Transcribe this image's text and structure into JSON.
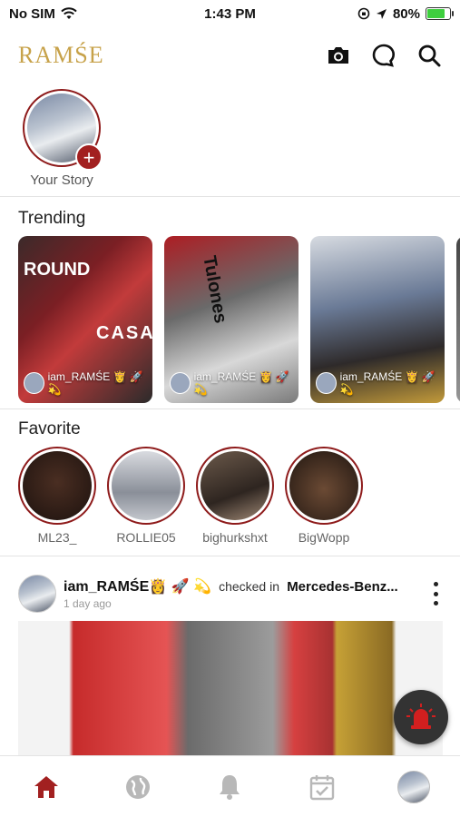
{
  "status_bar": {
    "carrier": "No SIM",
    "time": "1:43 PM",
    "battery_percent": "80%",
    "battery_level": 0.8
  },
  "header": {
    "logo": "RAMŚE"
  },
  "story": {
    "label": "Your Story",
    "add_symbol": "+"
  },
  "trending": {
    "title": "Trending",
    "cards": [
      {
        "user": "iam_RAMŚE 👸 🚀 💫",
        "overlay_top": "ROUND",
        "overlay_mid": "CASA"
      },
      {
        "user": "iam_RAMŚE 👸 🚀 💫",
        "overlay_top": "Tulones"
      },
      {
        "user": "iam_RAMŚE 👸 🚀 💫"
      }
    ]
  },
  "favorite": {
    "title": "Favorite",
    "items": [
      {
        "name": "ML23_"
      },
      {
        "name": "ROLLIE05"
      },
      {
        "name": "bighurkshxt"
      },
      {
        "name": "BigWopp"
      }
    ]
  },
  "post": {
    "user": "iam_RAMŚE👸 🚀 💫",
    "action": "checked in",
    "place": "Mercedes-Benz...",
    "time": "1 day ago"
  },
  "colors": {
    "brand_gold": "#c7a24a",
    "accent_red": "#a22020",
    "nav_active": "#a22020",
    "nav_inactive": "#b8b8b8"
  },
  "icons": {
    "camera": "camera-icon",
    "chat": "chat-icon",
    "search": "search-icon",
    "home": "home-icon",
    "globe": "globe-icon",
    "bell": "bell-icon",
    "calendar": "calendar-check-icon",
    "alert": "siren-icon"
  }
}
